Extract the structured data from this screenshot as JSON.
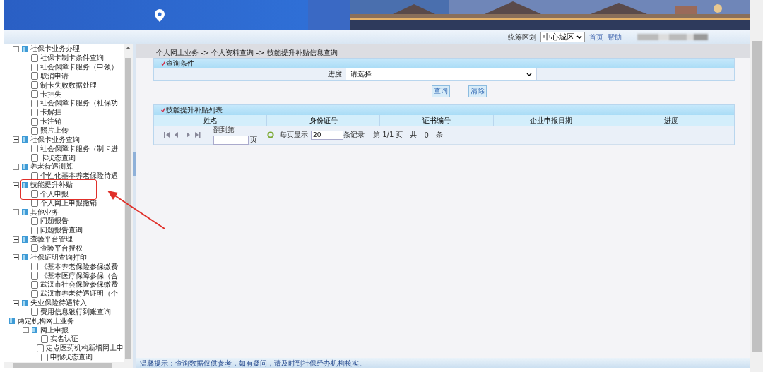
{
  "header": {
    "region_label": "统筹区划",
    "region_select": {
      "value": "中心城区"
    },
    "links": [
      "首页",
      "帮助"
    ]
  },
  "tree": [
    {
      "children": [
        {
          "label": "社保卡业务办理",
          "expanded": true,
          "children": [
            {
              "label": "社保卡制卡条件查询"
            },
            {
              "label": "社会保障卡服务（申领）"
            },
            {
              "label": "取消申请"
            },
            {
              "label": "制卡失败数据处理"
            },
            {
              "label": "卡挂失"
            },
            {
              "label": "社会保障卡服务（社保功"
            },
            {
              "label": "卡解挂"
            },
            {
              "label": "卡注销"
            },
            {
              "label": "照片上传"
            }
          ]
        },
        {
          "label": "社保卡业务查询",
          "expanded": true,
          "children": [
            {
              "label": "社会保障卡服务（制卡进"
            },
            {
              "label": "卡状态查询"
            }
          ]
        },
        {
          "label": "养老待遇测算",
          "expanded": true,
          "children": [
            {
              "label": "个性化基本养老保险待遇"
            }
          ]
        },
        {
          "label": "技能提升补贴",
          "expanded": true,
          "highlighted": true,
          "children": [
            {
              "label": "个人申报",
              "highlighted": true
            },
            {
              "label": "个人网上申报撤销"
            }
          ]
        },
        {
          "label": "其他业务",
          "expanded": true,
          "children": [
            {
              "label": "问题报告"
            },
            {
              "label": "问题报告查询"
            }
          ]
        },
        {
          "label": "查验平台管理",
          "expanded": true,
          "children": [
            {
              "label": "查验平台授权"
            }
          ]
        },
        {
          "label": "社保证明查询打印",
          "expanded": true,
          "children": [
            {
              "label": "《基本养老保险参保缴费"
            },
            {
              "label": "《基本医疗保障参保（合"
            },
            {
              "label": "武汉市社会保险参保缴费"
            },
            {
              "label": "武汉市养老待遇证明（个"
            }
          ]
        },
        {
          "label": "失业保险待遇转入",
          "expanded": true,
          "children": [
            {
              "label": "费用信息银行到账查询"
            }
          ]
        }
      ]
    },
    {
      "label": "两定机构网上业务",
      "children": [
        {
          "label": "网上申报",
          "expanded": true,
          "children": [
            {
              "label": "实名认证"
            },
            {
              "label": "定点医药机构新增网上申"
            },
            {
              "label": "申报状态查询"
            }
          ]
        }
      ]
    }
  ],
  "breadcrumb": "个人网上业务 -> 个人资料查询 -> 技能提升补贴信息查询",
  "query_panel": {
    "title": "查询条件",
    "field_label": "进度",
    "select": {
      "value": "请选择"
    },
    "buttons": [
      "查询",
      "清除"
    ]
  },
  "list_panel": {
    "title": "技能提升补贴列表",
    "columns": [
      "姓名",
      "身份证号",
      "证书编号",
      "企业申报日期",
      "进度"
    ],
    "pager": {
      "goto_label": "翻到第",
      "page_suffix": "页",
      "per_page_label": "每页显示",
      "per_page": "20",
      "records_label": "条记录",
      "page_info": "第 1/1 页",
      "total_label": "共",
      "total": "0",
      "total_suffix": "条"
    }
  },
  "footer_tip": "温馨提示：查询数据仅供参考，如有疑问，请及时到社保经办机构核实。"
}
